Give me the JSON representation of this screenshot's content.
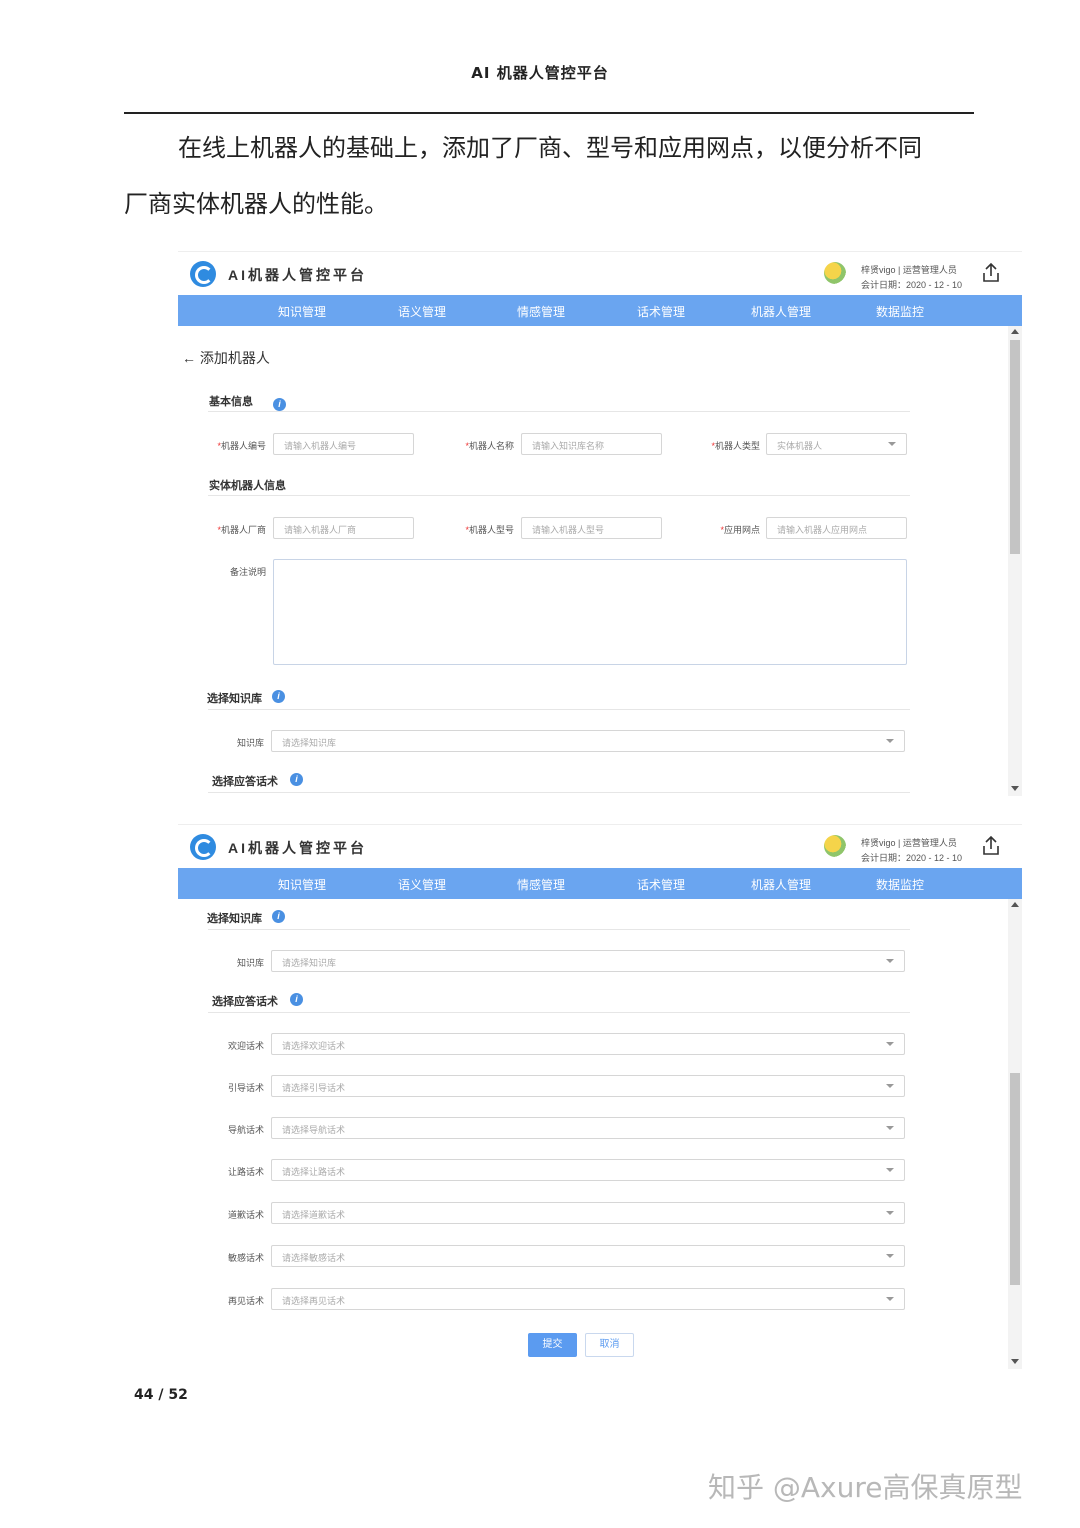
{
  "doc": {
    "header": "AI 机器人管控平台",
    "para_line1": "在线上机器人的基础上，添加了厂商、型号和应用网点，以便分析不同",
    "para_line2": "厂商实体机器人的性能。",
    "page_number": "44 / 52",
    "watermark": "知乎 @Axure高保真原型"
  },
  "app": {
    "brand": "AI机器人管控平台",
    "user": "梓贤vigo | 运营管理人员",
    "date": "会计日期：2020 - 12 - 10",
    "nav": [
      "知识管理",
      "语义管理",
      "情感管理",
      "话术管理",
      "机器人管理",
      "数据监控"
    ]
  },
  "form": {
    "back": "添加机器人",
    "section_basic": "基本信息",
    "section_entity": "实体机器人信息",
    "section_kb": "选择知识库",
    "section_reply": "选择应答话术",
    "required_mark": "*",
    "fields": {
      "robot_no": {
        "label": "机器人编号",
        "placeholder": "请输入机器人编号"
      },
      "robot_name": {
        "label": "机器人名称",
        "placeholder": "请输入知识库名称"
      },
      "robot_type": {
        "label": "机器人类型",
        "value": "实体机器人"
      },
      "vendor": {
        "label": "机器人厂商",
        "placeholder": "请输入机器人厂商"
      },
      "model": {
        "label": "机器人型号",
        "placeholder": "请输入机器人型号"
      },
      "site": {
        "label": "应用网点",
        "placeholder": "请输入机器人应用网点"
      },
      "remark": {
        "label": "备注说明"
      },
      "kb": {
        "label": "知识库",
        "placeholder": "请选择知识库"
      }
    },
    "speech": [
      {
        "label": "欢迎话术",
        "placeholder": "请选择欢迎话术"
      },
      {
        "label": "引导话术",
        "placeholder": "请选择引导话术"
      },
      {
        "label": "导航话术",
        "placeholder": "请选择导航话术"
      },
      {
        "label": "让路话术",
        "placeholder": "请选择让路话术"
      },
      {
        "label": "道歉话术",
        "placeholder": "请选择道歉话术"
      },
      {
        "label": "敏感话术",
        "placeholder": "请选择敏感话术"
      },
      {
        "label": "再见话术",
        "placeholder": "请选择再见话术"
      }
    ],
    "submit": "提交",
    "cancel": "取消"
  },
  "colors": {
    "nav_bg": "#6aa5f0",
    "primary": "#5b9bf0",
    "info": "#4a90e2",
    "required": "#e33333"
  }
}
